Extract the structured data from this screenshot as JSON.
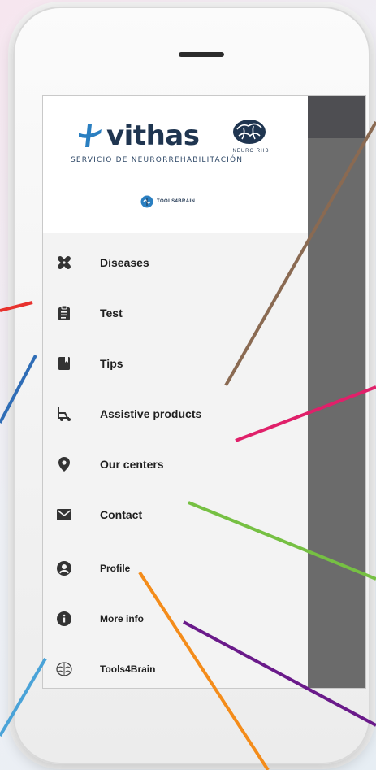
{
  "header": {
    "brand_name": "vithas",
    "neuro_label": "NEURO RHB",
    "service_label": "SERVICIO DE NEURORREHABILITACIÓN",
    "tools4brain_label": "TOOLS4BRAIN"
  },
  "menu": {
    "items": [
      {
        "label": "Diseases",
        "icon": "bandage-icon"
      },
      {
        "label": "Test",
        "icon": "clipboard-icon"
      },
      {
        "label": "Tips",
        "icon": "notebook-icon"
      },
      {
        "label": "Assistive products",
        "icon": "wheelchair-icon"
      },
      {
        "label": "Our centers",
        "icon": "location-pin-icon"
      },
      {
        "label": "Contact",
        "icon": "envelope-icon"
      },
      {
        "label": "Profile",
        "icon": "user-circle-icon"
      },
      {
        "label": "More info",
        "icon": "info-circle-icon"
      },
      {
        "label": "Tools4Brain",
        "icon": "brain-icon"
      }
    ]
  },
  "colors": {
    "brand_navy": "#1f3550",
    "brand_blue": "#2a7fc1",
    "overlay": "#6b6b6b"
  }
}
